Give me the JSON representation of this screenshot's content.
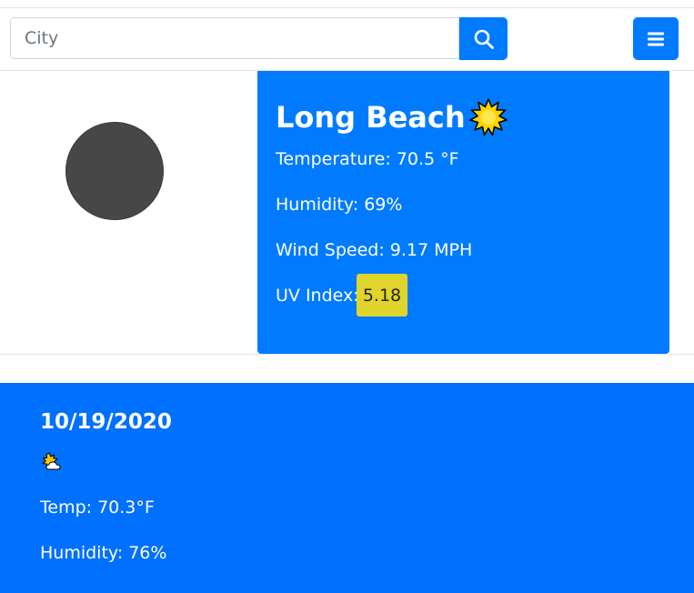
{
  "search": {
    "placeholder": "City",
    "value": "",
    "button_icon": "search-icon"
  },
  "menu": {
    "icon": "hamburger-menu-icon"
  },
  "current": {
    "city": "Long Beach",
    "condition_icon": "sun-icon",
    "temperature": "Temperature: 70.5 °F",
    "humidity": "Humidity: 69%",
    "wind_speed": "Wind Speed: 9.17 MPH",
    "uv_label": "UV Index:",
    "uv_value": "5.18",
    "uv_color": "#e0d52a"
  },
  "forecast": [
    {
      "date": "10/19/2020",
      "condition_icon": "partly-cloudy-icon",
      "temp": "Temp: 70.3°F",
      "humidity": "Humidity: 76%"
    }
  ],
  "colors": {
    "primary": "#007bff",
    "forecast_bg": "#0070ff",
    "avatar": "#474747"
  }
}
